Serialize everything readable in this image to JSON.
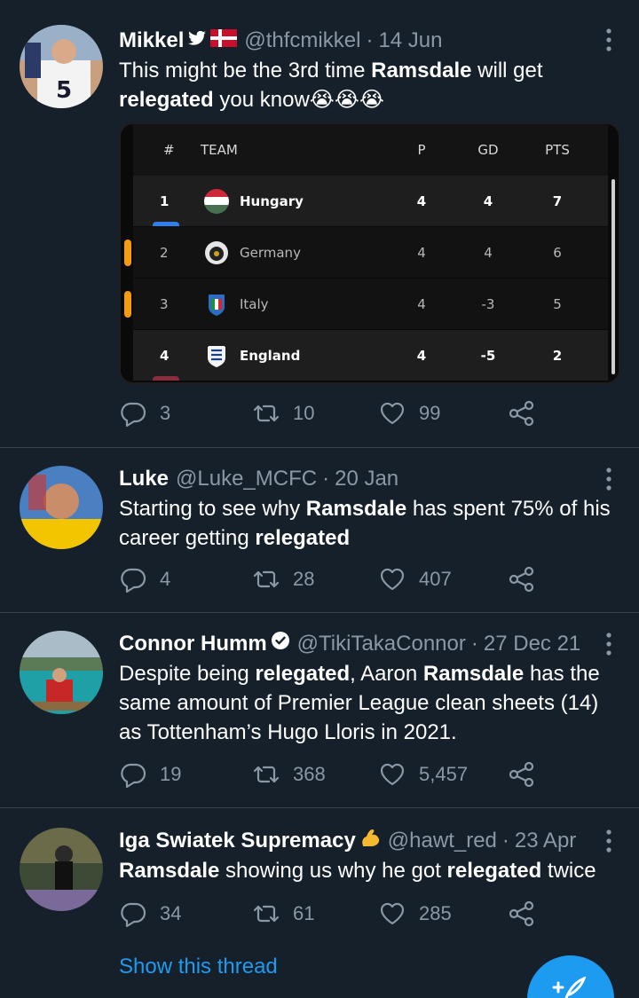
{
  "tweets": [
    {
      "name": "Mikkel",
      "handle": "@thfcmikkel",
      "sep": "·",
      "date": "14 Jun",
      "text_parts": [
        "This might be the 3rd time ",
        "Ramsdale",
        " will get ",
        "relegated",
        " you know",
        "😭😭😭"
      ],
      "replies": "3",
      "retweets": "10",
      "likes": "99"
    },
    {
      "name": "Luke",
      "handle": "@Luke_MCFC",
      "sep": "·",
      "date": "20 Jan",
      "text_parts": [
        "Starting to see why ",
        "Ramsdale",
        " has spent 75% of his career getting ",
        "relegated"
      ],
      "replies": "4",
      "retweets": "28",
      "likes": "407"
    },
    {
      "name": "Connor Humm",
      "handle": "@TikiTakaConnor",
      "sep": "·",
      "date": "27 Dec 21",
      "text_parts": [
        "Despite being ",
        "relegated",
        ", Aaron ",
        "Ramsdale",
        " has the same amount of Premier League clean sheets (14) as Tottenham’s Hugo Lloris in 2021."
      ],
      "replies": "19",
      "retweets": "368",
      "likes": "5,457"
    },
    {
      "name": "Iga Swiatek Supremacy",
      "handle": "@hawt_red",
      "sep": "·",
      "date": "23 Apr",
      "text_parts": [
        "Ramsdale",
        " showing us why he got ",
        "relegated",
        " twice"
      ],
      "replies": "34",
      "retweets": "61",
      "likes": "285",
      "show_thread": "Show this thread"
    }
  ],
  "standings": {
    "headers": {
      "pos": "#",
      "team": "TEAM",
      "p": "P",
      "gd": "GD",
      "pts": "PTS"
    },
    "rows": [
      {
        "pos": "1",
        "team": "Hungary",
        "p": "4",
        "gd": "4",
        "pts": "7"
      },
      {
        "pos": "2",
        "team": "Germany",
        "p": "4",
        "gd": "4",
        "pts": "6"
      },
      {
        "pos": "3",
        "team": "Italy",
        "p": "4",
        "gd": "-3",
        "pts": "5"
      },
      {
        "pos": "4",
        "team": "England",
        "p": "4",
        "gd": "-5",
        "pts": "2"
      }
    ]
  },
  "colors": {
    "background": "#15202b",
    "accent": "#1d9bf0",
    "muted": "#8b98a5",
    "promotion": "#2f80ed",
    "playoff": "#f39c12",
    "relegation": "#8b2c3f"
  },
  "icons": {
    "reply": "reply-icon",
    "retweet": "retweet-icon",
    "like": "heart-icon",
    "share": "share-icon",
    "more": "more-vertical-icon",
    "compose": "compose-icon"
  }
}
